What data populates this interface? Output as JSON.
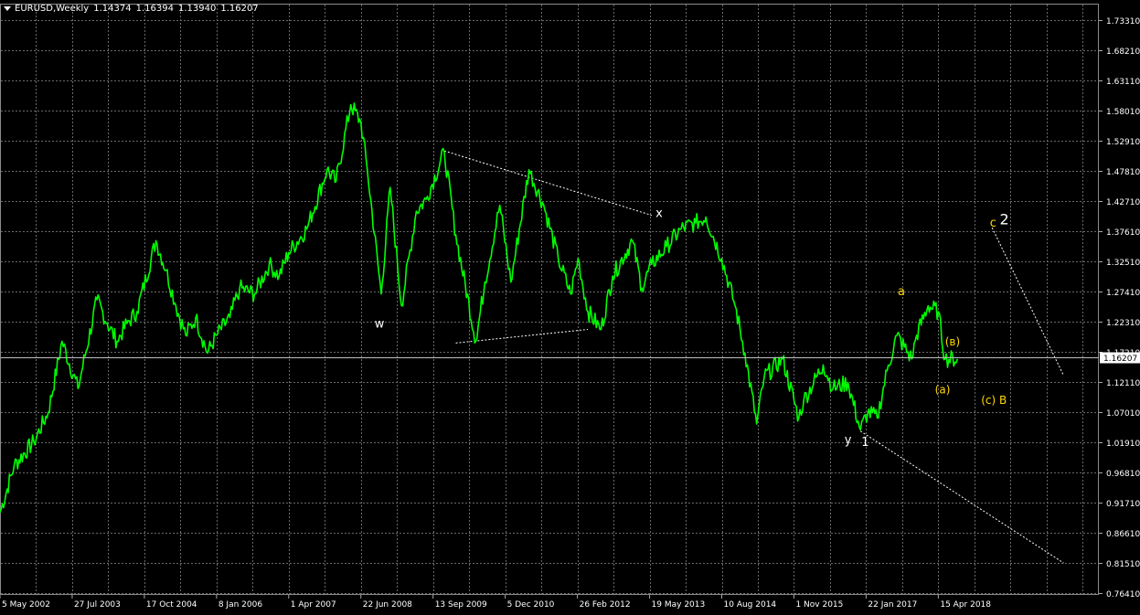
{
  "header": {
    "symbol": "EURUSD,Weekly",
    "open": "1.14374",
    "high": "1.16394",
    "low": "1.13940",
    "close": "1.16207"
  },
  "colors": {
    "background": "#000000",
    "grid": "#6a6a6a",
    "price_line": "#00ff00",
    "axis_text": "#ffffff",
    "wave_yellow": "#ffd800",
    "wave_white": "#ffffff"
  },
  "chart_data": {
    "type": "line",
    "ylim": [
      0.7641,
      1.7331
    ],
    "y_ticks": [
      "1.73310",
      "1.68210",
      "1.63110",
      "1.58010",
      "1.52910",
      "1.47810",
      "1.42710",
      "1.37610",
      "1.32510",
      "1.27410",
      "1.22310",
      "1.17210",
      "1.12110",
      "1.07010",
      "1.01910",
      "0.96810",
      "0.91710",
      "0.86610",
      "0.81510",
      "0.76410"
    ],
    "x_ticks": [
      "5 May 2002",
      "27 Jul 2003",
      "17 Oct 2004",
      "8 Jan 2006",
      "1 Apr 2007",
      "22 Jun 2008",
      "13 Sep 2009",
      "5 Dec 2010",
      "26 Feb 2012",
      "19 May 2013",
      "10 Aug 2014",
      "1 Nov 2015",
      "22 Jan 2017",
      "15 Apr 2018"
    ],
    "x_tick_dates": [
      "2002-05-05",
      "2003-07-27",
      "2004-10-17",
      "2006-01-08",
      "2007-04-01",
      "2008-06-22",
      "2009-09-13",
      "2010-12-05",
      "2012-02-26",
      "2013-05-19",
      "2014-08-10",
      "2015-11-01",
      "2017-01-22",
      "2018-04-15"
    ],
    "x_range": [
      "2002-05-05",
      "2020-12-31"
    ],
    "current_price": "1.16207",
    "series": [
      {
        "dates": [
          "2002-05-05",
          "2002-08-01",
          "2002-12-01",
          "2003-03-01",
          "2003-05-25",
          "2003-09-01",
          "2003-12-28",
          "2004-03-01",
          "2004-05-01",
          "2004-07-01",
          "2004-09-01",
          "2004-12-28",
          "2005-03-01",
          "2005-05-01",
          "2005-07-01",
          "2005-09-01",
          "2005-11-13",
          "2006-01-08",
          "2006-04-01",
          "2006-06-01",
          "2006-09-01",
          "2006-12-01",
          "2007-02-01",
          "2007-04-01",
          "2007-07-22",
          "2007-11-25",
          "2008-01-20",
          "2008-04-20",
          "2008-06-22",
          "2008-08-01",
          "2008-10-26",
          "2008-12-21",
          "2009-03-01",
          "2009-06-01",
          "2009-08-01",
          "2009-11-22",
          "2010-02-01",
          "2010-06-06",
          "2010-08-01",
          "2010-11-01",
          "2011-01-09",
          "2011-05-01",
          "2011-08-01",
          "2011-10-30",
          "2012-01-15",
          "2012-03-01",
          "2012-05-01",
          "2012-07-22",
          "2012-10-01",
          "2013-02-01",
          "2013-04-01",
          "2013-06-01",
          "2013-09-01",
          "2013-12-01",
          "2014-03-01",
          "2014-05-04",
          "2014-08-10",
          "2014-11-01",
          "2015-01-01",
          "2015-03-15",
          "2015-05-01",
          "2015-08-23",
          "2015-12-01",
          "2016-01-01",
          "2016-05-01",
          "2016-07-01",
          "2016-10-01",
          "2016-12-18",
          "2017-02-01",
          "2017-04-01",
          "2017-06-01",
          "2017-08-01",
          "2017-11-01",
          "2017-12-01",
          "2018-02-11",
          "2018-04-15",
          "2018-05-27",
          "2018-08-12"
        ],
        "values": [
          0.9,
          0.98,
          1.02,
          1.07,
          1.19,
          1.11,
          1.26,
          1.22,
          1.19,
          1.22,
          1.24,
          1.36,
          1.31,
          1.25,
          1.2,
          1.23,
          1.17,
          1.2,
          1.23,
          1.28,
          1.27,
          1.32,
          1.3,
          1.34,
          1.38,
          1.48,
          1.46,
          1.59,
          1.56,
          1.48,
          1.27,
          1.45,
          1.25,
          1.41,
          1.43,
          1.51,
          1.37,
          1.19,
          1.29,
          1.42,
          1.29,
          1.48,
          1.42,
          1.33,
          1.27,
          1.33,
          1.24,
          1.21,
          1.3,
          1.36,
          1.28,
          1.32,
          1.35,
          1.38,
          1.39,
          1.4,
          1.33,
          1.25,
          1.17,
          1.05,
          1.13,
          1.16,
          1.06,
          1.09,
          1.15,
          1.11,
          1.12,
          1.04,
          1.07,
          1.06,
          1.14,
          1.2,
          1.16,
          1.2,
          1.25,
          1.24,
          1.16,
          1.16
        ]
      }
    ],
    "trendlines": [
      {
        "dates": [
          "2009-11-22",
          "2013-06-01"
        ],
        "values": [
          1.512,
          1.403
        ]
      },
      {
        "dates": [
          "2010-02-01",
          "2012-05-01"
        ],
        "values": [
          1.187,
          1.21
        ]
      },
      {
        "dates": [
          "2016-12-18",
          "2020-06-01"
        ],
        "values": [
          1.038,
          0.815
        ]
      },
      {
        "dates": [
          "2019-03-15",
          "2020-06-01"
        ],
        "values": [
          1.382,
          1.132
        ]
      }
    ],
    "annotations": [
      {
        "text": "w",
        "date": "2008-09-15",
        "value": 1.213,
        "color": "#ffffff",
        "size": 13
      },
      {
        "text": "x",
        "date": "2013-06-25",
        "value": 1.4,
        "color": "#ffffff",
        "size": 13
      },
      {
        "text": "y",
        "date": "2016-09-10",
        "value": 1.017,
        "color": "#ffffff",
        "size": 13
      },
      {
        "text": "1",
        "date": "2016-12-24",
        "value": 1.013,
        "color": "#ffffff",
        "size": 13
      },
      {
        "text": "a",
        "date": "2017-08-06",
        "value": 1.268,
        "color": "#ffd800",
        "size": 13
      },
      {
        "text": "(в)",
        "date": "2018-05-27",
        "value": 1.183,
        "color": "#ffd800",
        "size": 12
      },
      {
        "text": "(a)",
        "date": "2018-03-25",
        "value": 1.102,
        "color": "#ffd800",
        "size": 12
      },
      {
        "text": "(c) B",
        "date": "2019-01-06",
        "value": 1.084,
        "color": "#ffd800",
        "size": 12
      },
      {
        "text": "c",
        "date": "2019-03-01",
        "value": 1.384,
        "color": "#ffd800",
        "size": 13
      },
      {
        "text": "2",
        "date": "2019-05-01",
        "value": 1.388,
        "color": "#ffffff",
        "size": 16
      }
    ]
  }
}
